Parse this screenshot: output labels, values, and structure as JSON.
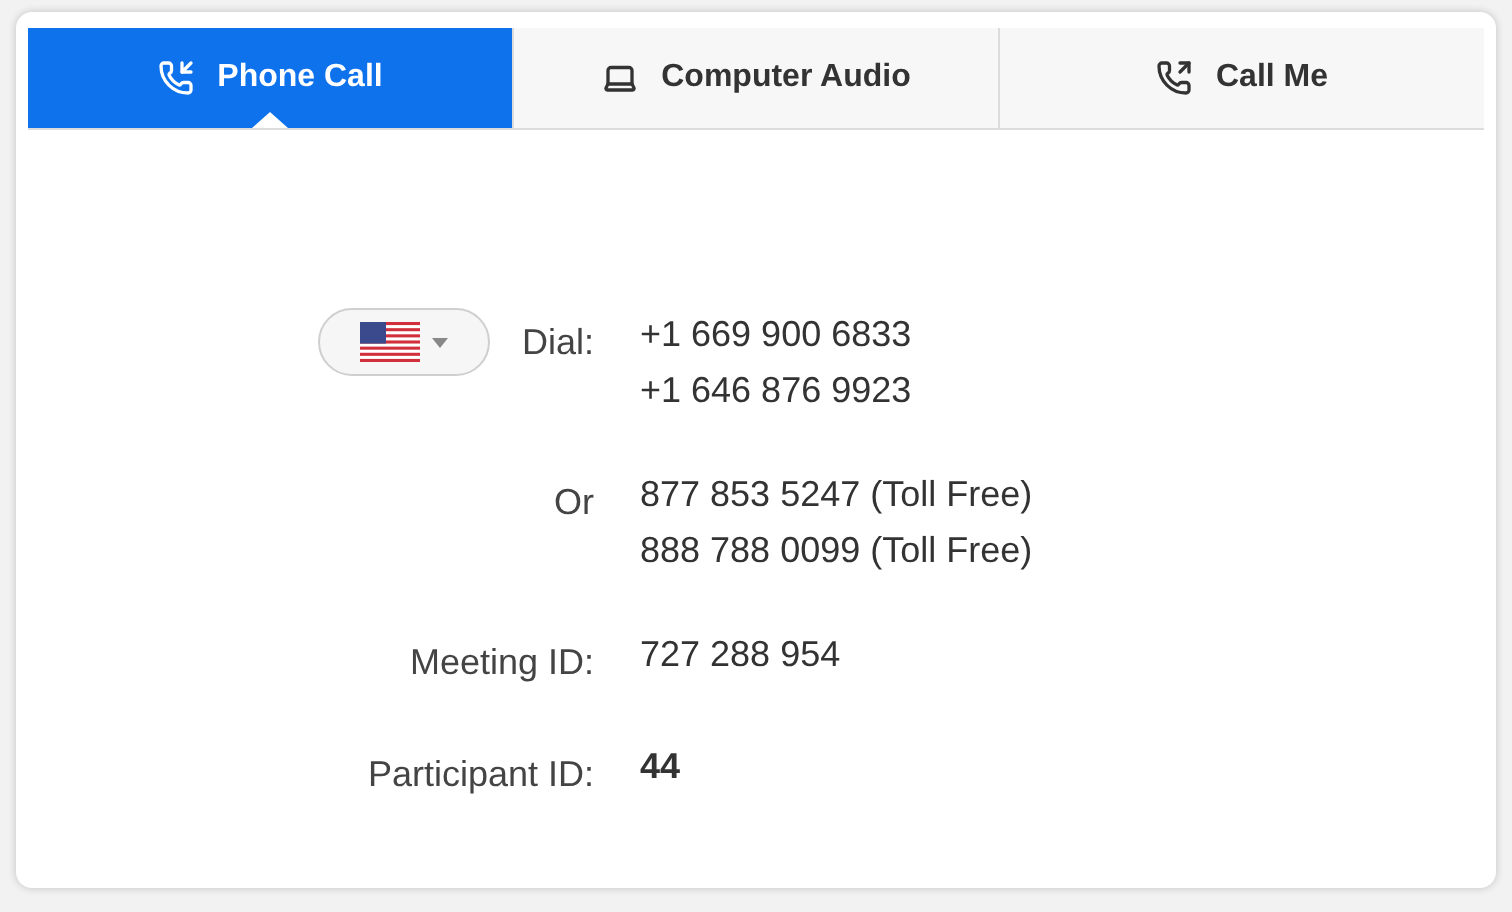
{
  "tabs": [
    {
      "label": "Phone Call",
      "kind": "phone-incoming",
      "selected": true
    },
    {
      "label": "Computer Audio",
      "kind": "laptop",
      "selected": false
    },
    {
      "label": "Call Me",
      "kind": "phone-outgoing",
      "selected": false
    }
  ],
  "rows": [
    {
      "kind": "dial",
      "label": "Dial:",
      "values": [
        "+1 669 900 6833",
        "+1 646 876 9923"
      ]
    },
    {
      "kind": "plain",
      "label": "Or",
      "values": [
        "877 853 5247 (Toll Free)",
        "888 788 0099 (Toll Free)"
      ]
    },
    {
      "kind": "plain",
      "label": "Meeting ID:",
      "values": [
        "727 288 954"
      ]
    },
    {
      "kind": "bold",
      "label": "Participant ID:",
      "values": [
        "44"
      ]
    }
  ]
}
